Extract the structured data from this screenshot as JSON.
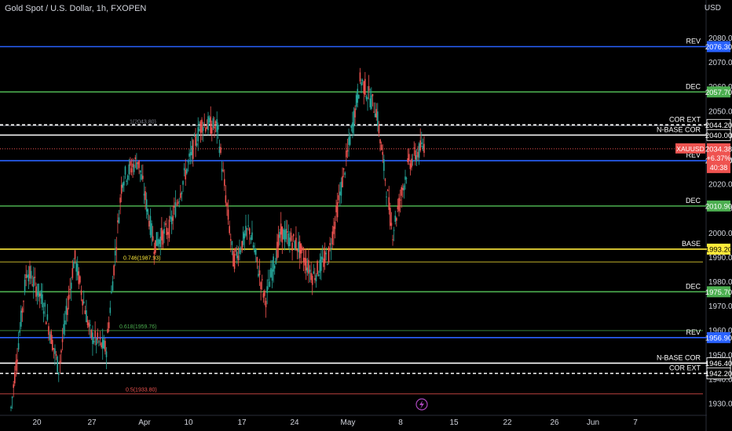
{
  "header": {
    "title": "Gold Spot / U.S. Dollar, 1h, FXOPEN",
    "currency": "USD"
  },
  "colors": {
    "background": "#000000",
    "up": "#26a69a",
    "down": "#ef5350",
    "blue": "#2962ff",
    "green": "#4caf50",
    "yellow": "#ffeb3b",
    "white": "#ffffff",
    "red_line": "#b71c1c",
    "axis_text": "#d1d4dc"
  },
  "chart_data": {
    "type": "candlestick",
    "symbol": "XAUUSD",
    "ylim": [
      1925,
      2089
    ],
    "y_ticks": [
      1930,
      1940,
      1950,
      1960,
      1970,
      1980,
      1990,
      2000,
      2010,
      2020,
      2030,
      2040,
      2050,
      2060,
      2070,
      2080
    ],
    "x_ticks": [
      "20",
      "27",
      "Apr",
      "10",
      "17",
      "24",
      "May",
      "8",
      "15",
      "22",
      "26",
      "Jun",
      "7"
    ],
    "price_path": [
      [
        "20",
        1928
      ],
      [
        "20",
        1985
      ],
      [
        "20",
        1972
      ],
      [
        "27",
        1944
      ],
      [
        "27",
        1990
      ],
      [
        "27",
        1958
      ],
      [
        "Apr",
        1952
      ],
      [
        "Apr",
        2022
      ],
      [
        "Apr",
        2030
      ],
      [
        "10",
        1995
      ],
      [
        "10",
        2002
      ],
      [
        "10",
        2025
      ],
      [
        "17",
        2045
      ],
      [
        "17",
        2043
      ],
      [
        "17",
        1988
      ],
      [
        "24",
        2002
      ],
      [
        "24",
        1972
      ],
      [
        "24",
        2000
      ],
      [
        "May",
        1995
      ],
      [
        "May",
        1982
      ],
      [
        "May",
        1991
      ],
      [
        "May",
        2026
      ],
      [
        "May",
        2063
      ],
      [
        "May",
        2050
      ],
      [
        "8",
        2000
      ],
      [
        "8",
        2028
      ],
      [
        "8",
        2036
      ]
    ],
    "levels": [
      {
        "label": "REV",
        "price": 2076.3,
        "price_label": "2076.30",
        "color": "blue",
        "style": "solid"
      },
      {
        "label": "DEC",
        "price": 2057.7,
        "price_label": "2057.70",
        "color": "green",
        "style": "solid"
      },
      {
        "label": "COR EXT",
        "price": 2044.2,
        "price_label": "2044.20",
        "color": "white",
        "style": "dashed"
      },
      {
        "label": "N-BASE COR",
        "price": 2040.0,
        "price_label": "2040.00",
        "color": "white",
        "style": "solid"
      },
      {
        "label": "REV",
        "price": 2029.5,
        "price_label": "2029.50",
        "color": "blue",
        "style": "solid"
      },
      {
        "label": "DEC",
        "price": 2010.9,
        "price_label": "2010.90",
        "color": "green",
        "style": "solid"
      },
      {
        "label": "BASE",
        "price": 1993.2,
        "price_label": "1993.20",
        "color": "yellow",
        "style": "solid"
      },
      {
        "label": "DEC",
        "price": 1975.7,
        "price_label": "1975.70",
        "color": "green",
        "style": "solid"
      },
      {
        "label": "REV",
        "price": 1956.9,
        "price_label": "1956.90",
        "color": "blue",
        "style": "solid"
      },
      {
        "label": "N-BASE COR",
        "price": 1946.4,
        "price_label": "1946.40",
        "color": "white",
        "style": "solid"
      },
      {
        "label": "COR EXT",
        "price": 1942.2,
        "price_label": "1942.20",
        "color": "white",
        "style": "dashed"
      }
    ],
    "fib_lines": [
      {
        "label": "1(2043.80)",
        "price": 2043.8,
        "color": "#787b86"
      },
      {
        "label": "0.746(1987.93)",
        "price": 1987.93,
        "color": "#ffeb3b"
      },
      {
        "label": "0.618(1959.76)",
        "price": 1959.76,
        "color": "#4caf50"
      },
      {
        "label": "0.5(1933.80)",
        "price": 1933.8,
        "color": "#ef5350"
      }
    ],
    "current": {
      "symbol": "XAUUSD",
      "price": 2034.38,
      "price_label": "2034.38",
      "change": "+6.37%",
      "countdown": "40:38"
    }
  }
}
